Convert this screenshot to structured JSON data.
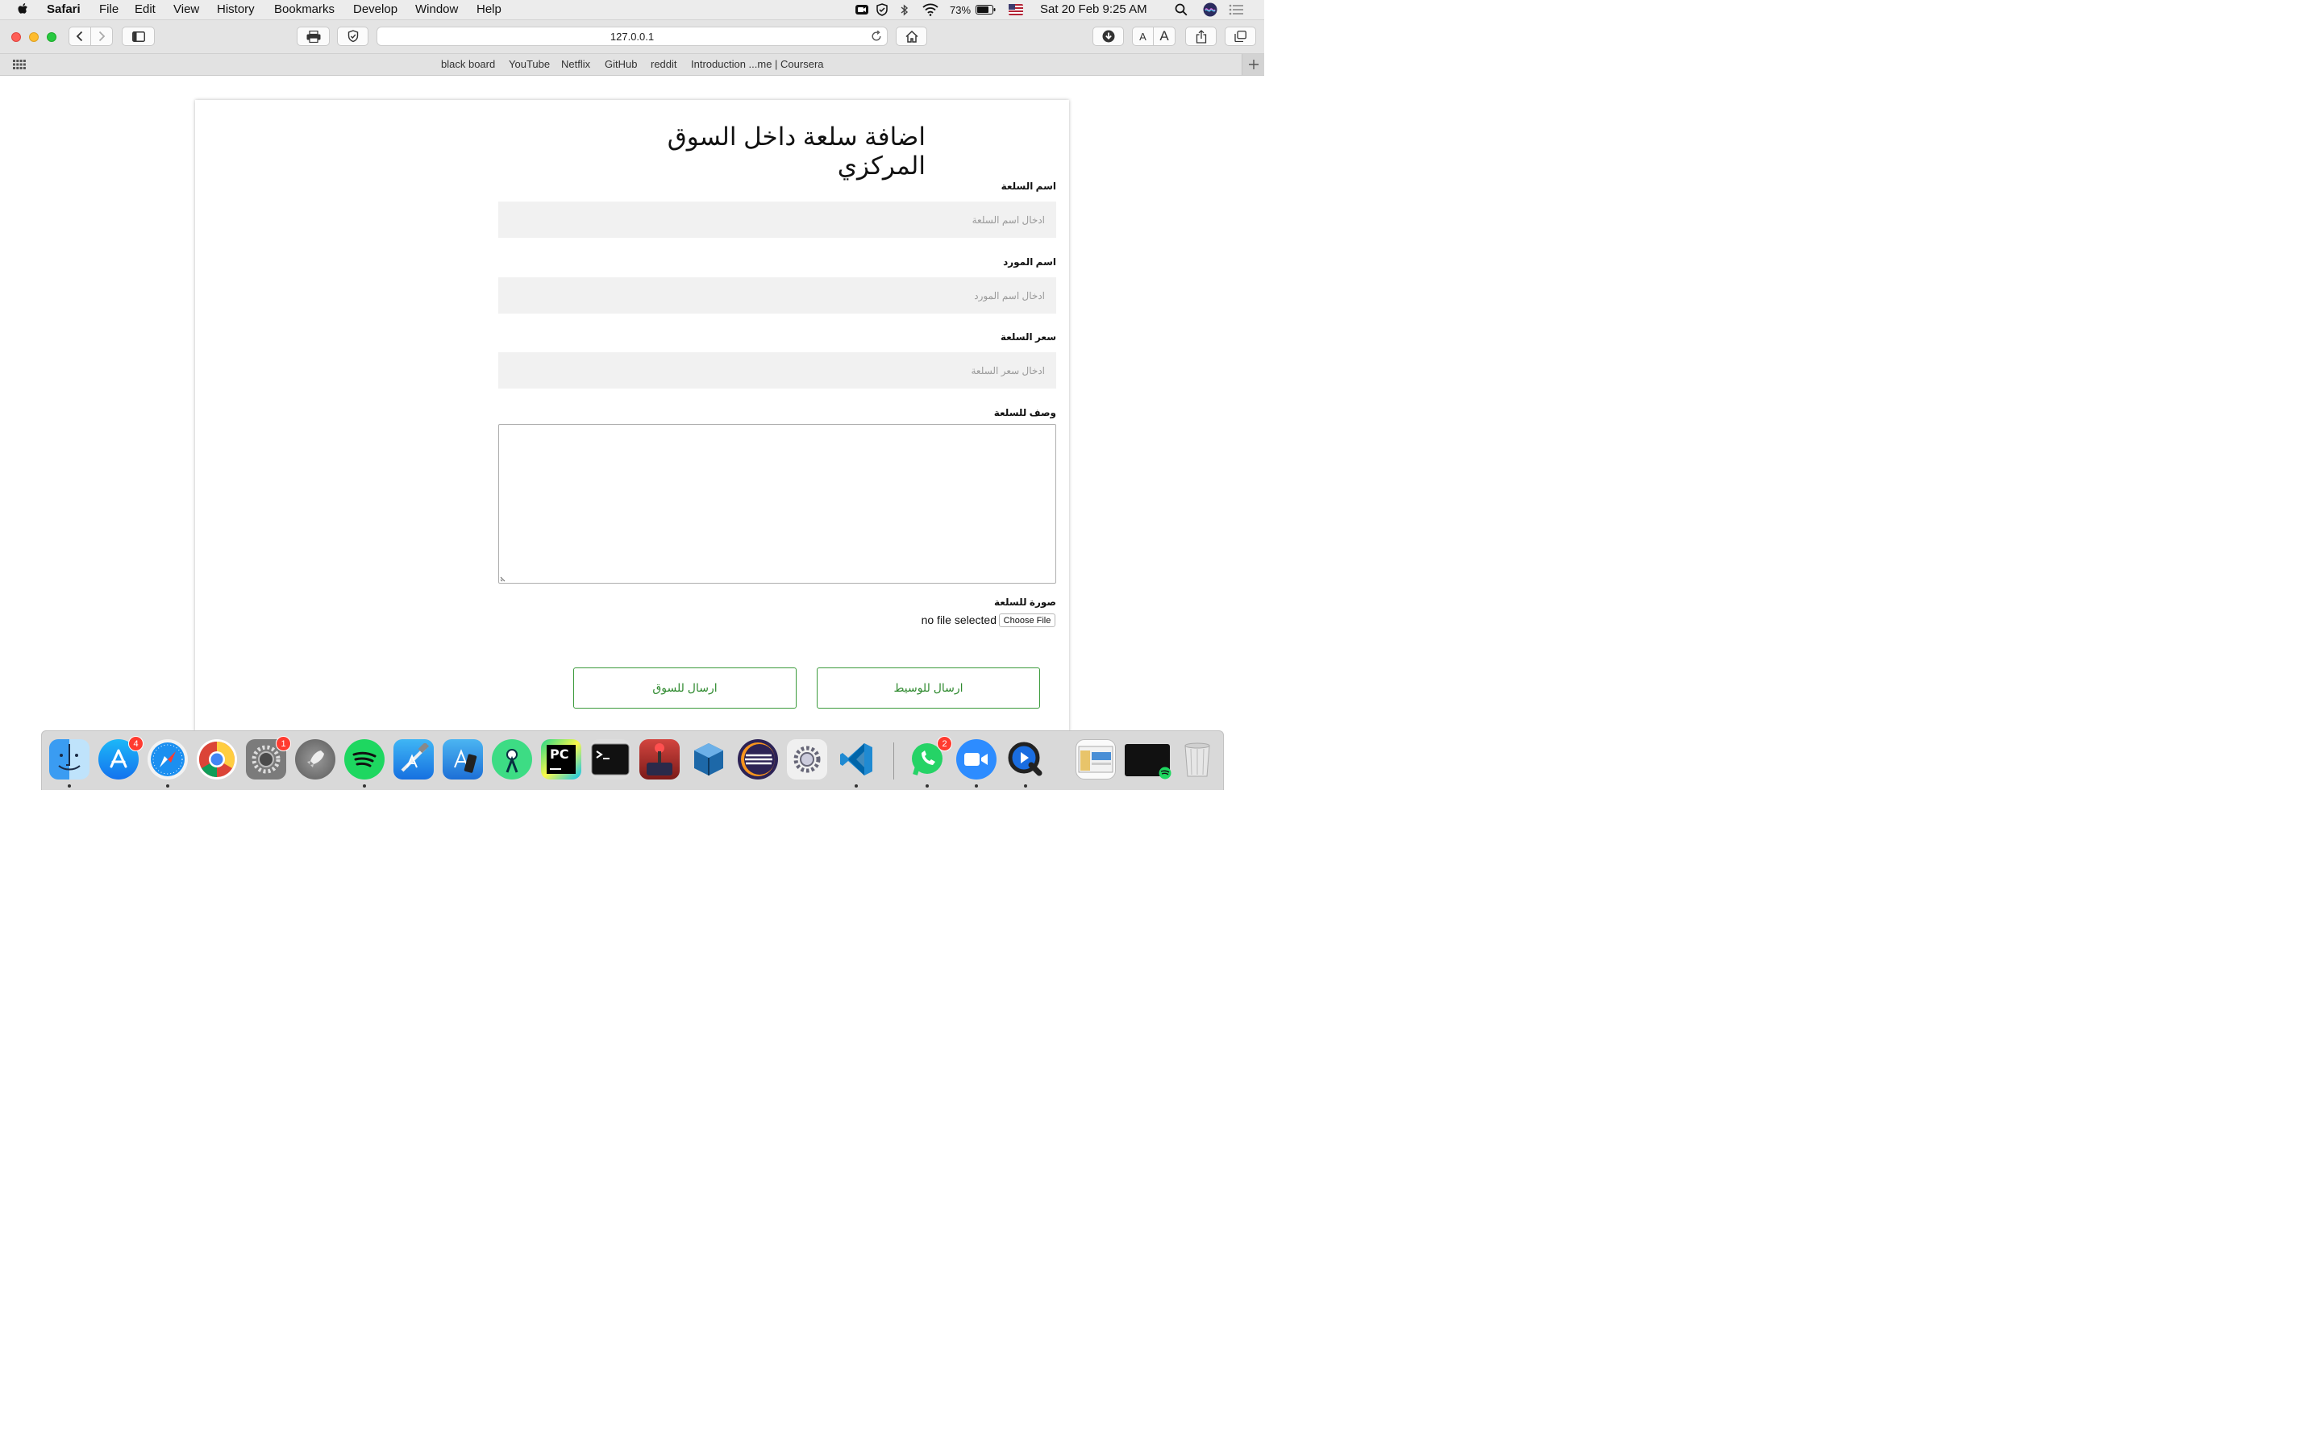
{
  "menubar": {
    "app_name": "Safari",
    "items": [
      "File",
      "Edit",
      "View",
      "History",
      "Bookmarks",
      "Develop",
      "Window",
      "Help"
    ],
    "battery_percent": "73%",
    "clock": "Sat 20 Feb  9:25 AM"
  },
  "browser": {
    "url": "127.0.0.1",
    "favorites": [
      "black board",
      "YouTube",
      "Netflix",
      "GitHub",
      "reddit",
      "Introduction ...me | Coursera"
    ]
  },
  "form": {
    "title": "اضافة سلعة داخل السوق المركزي",
    "item_name": {
      "label": "اسم السلعة",
      "placeholder": "ادخال اسم السلعة"
    },
    "supplier_name": {
      "label": "اسم المورد",
      "placeholder": "ادخال اسم المورد"
    },
    "item_price": {
      "label": "سعر السلعة",
      "placeholder": "ادخال سعر السلعة"
    },
    "description": {
      "label": "وصف للسلعة"
    },
    "image": {
      "label": "صورة للسلعة",
      "status": "no file selected",
      "choose_label": "Choose File"
    },
    "send_to_broker_label": "ارسال للوسيط",
    "send_to_market_label": "ارسال للسوق"
  },
  "dock": {
    "badges": {
      "app_store": "4",
      "system_preferences": "1",
      "whatsapp": "2"
    },
    "pycharm_label": "PC"
  },
  "colors": {
    "button_border": "#3a9a3a",
    "button_text": "#2f8a2f",
    "input_bg": "#f1f1f1",
    "badge": "#ff3b30"
  }
}
